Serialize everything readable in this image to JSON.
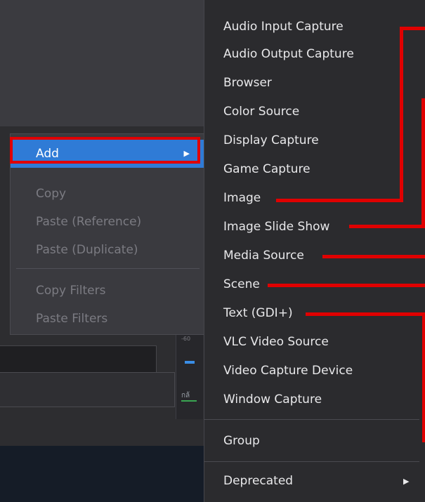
{
  "context_menu": {
    "items": [
      {
        "label": "Add",
        "active": true,
        "enabled": true,
        "has_submenu": true
      },
      {
        "label": "Copy",
        "enabled": false
      },
      {
        "label": "Paste (Reference)",
        "enabled": false
      },
      {
        "label": "Paste (Duplicate)",
        "enabled": false
      },
      {
        "label": "Copy Filters",
        "enabled": false
      },
      {
        "label": "Paste Filters",
        "enabled": false
      }
    ],
    "highlighted_item": "Add",
    "submenu_arrow_icon": "triangle-right"
  },
  "add_submenu": {
    "sources": [
      "Audio Input Capture",
      "Audio Output Capture",
      "Browser",
      "Color Source",
      "Display Capture",
      "Game Capture",
      "Image",
      "Image Slide Show",
      "Media Source",
      "Scene",
      "Text (GDI+)",
      "VLC Video Source",
      "Video Capture Device",
      "Window Capture"
    ],
    "group_label": "Group",
    "deprecated_label": "Deprecated"
  },
  "background": {
    "strip_label": "กล้"
  },
  "colors": {
    "menu_background": "#3a3a3f",
    "submenu_background": "#2b2b2e",
    "highlight": "#2f7bd6",
    "annotation_red": "#e00000",
    "text": "#e8e8ea",
    "disabled_text": "#7b7b82"
  }
}
